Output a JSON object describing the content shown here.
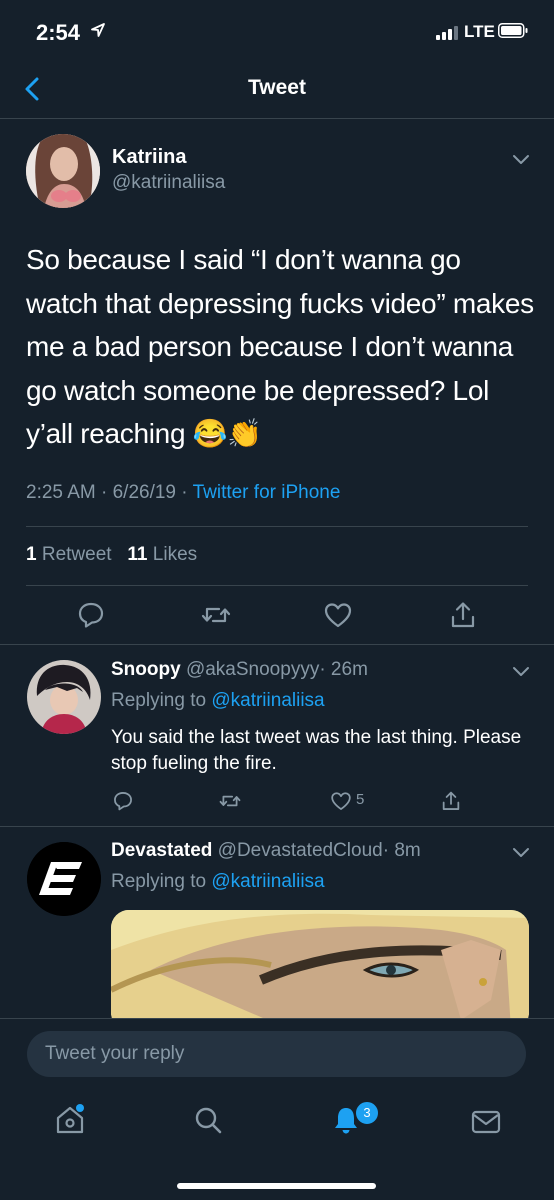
{
  "status_bar": {
    "time": "2:54",
    "network": "LTE"
  },
  "nav": {
    "title": "Tweet",
    "back_icon": "chevron-left-icon"
  },
  "main_tweet": {
    "name": "Katriina",
    "handle": "@katriinaliisa",
    "text": "So because I said “I don’t wanna go watch that depressing fucks video” makes me a bad person because I don’t wanna go watch someone be depressed? Lol y’all reaching 😂👏",
    "time": "2:25 AM",
    "sep": "·",
    "date": "6/26/19",
    "source": "Twitter for iPhone",
    "retweets_count": "1",
    "retweets_label": "Retweet",
    "likes_count": "11",
    "likes_label": "Likes"
  },
  "replies": [
    {
      "name": "Snoopy",
      "handle": "@akaSnoopyyy",
      "age": "· 26m",
      "replying_label": "Replying to",
      "replying_to": "@katriinaliisa",
      "text": "You said the last tweet was the last thing. Please stop fueling the fire.",
      "like_count": "5"
    },
    {
      "name": "Devastated",
      "handle": "@DevastatedCloud",
      "age": "· 8m",
      "replying_label": "Replying to",
      "replying_to": "@katriinaliisa"
    }
  ],
  "reply_bar": {
    "placeholder": "Tweet your reply"
  },
  "tab_bar": {
    "notifications_badge": "3"
  },
  "colors": {
    "background": "#15202b",
    "accent": "#1da1f2",
    "secondary_text": "#8899a6",
    "divider": "#38444d"
  }
}
